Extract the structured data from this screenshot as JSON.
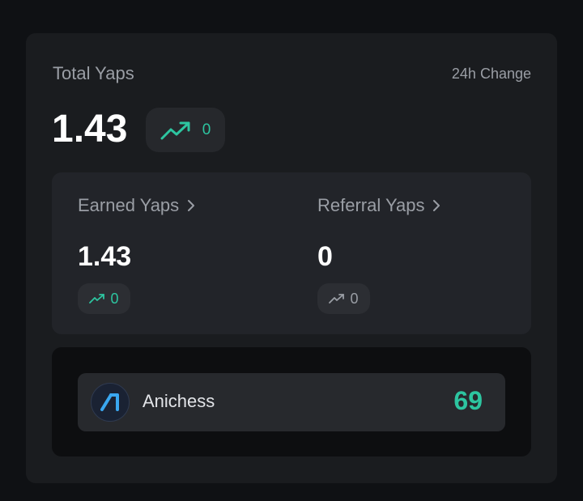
{
  "total": {
    "title": "Total Yaps",
    "change_label": "24h Change",
    "value": "1.43",
    "change": "0",
    "trend_icon": "trend-up-icon"
  },
  "earned": {
    "label": "Earned Yaps",
    "value": "1.43",
    "change": "0",
    "chevron_icon": "chevron-right-icon"
  },
  "referral": {
    "label": "Referral Yaps",
    "value": "0",
    "change": "0",
    "chevron_icon": "chevron-right-icon"
  },
  "projects": [
    {
      "name": "Anichess",
      "score": "69",
      "logo_icon": "anichess-logo-icon"
    }
  ],
  "colors": {
    "accent": "#2dc5a0",
    "card": "#1a1c1f",
    "muted": "#9a9ea5"
  }
}
